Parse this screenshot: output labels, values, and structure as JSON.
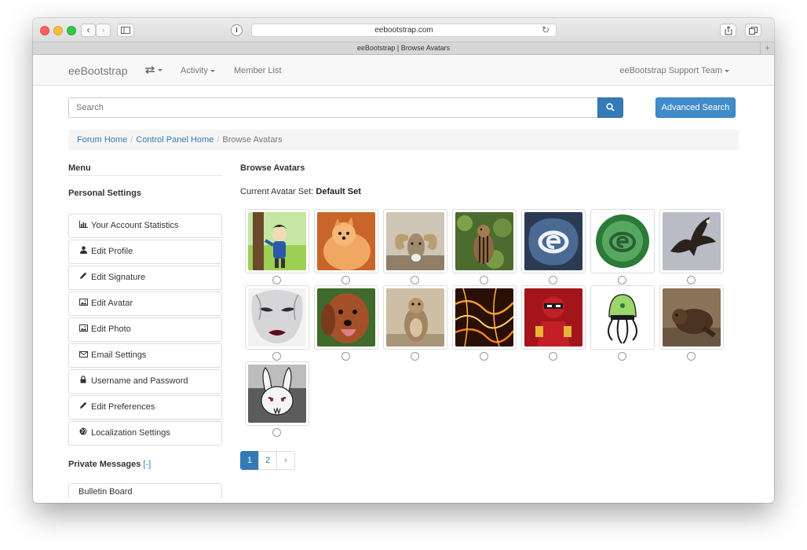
{
  "browser": {
    "url": "eebootstrap.com",
    "tab_title": "eeBootstrap | Browse Avatars"
  },
  "navbar": {
    "brand": "eeBootstrap",
    "activity": "Activity",
    "member_list": "Member List",
    "user_menu": "eeBootstrap Support Team"
  },
  "search": {
    "placeholder": "Search",
    "advanced_label": "Advanced Search"
  },
  "breadcrumb": {
    "items": [
      "Forum Home",
      "Control Panel Home"
    ],
    "current": "Browse Avatars"
  },
  "sidebar": {
    "menu_title": "Menu",
    "personal_title": "Personal Settings",
    "items": [
      {
        "label": "Your Account Statistics",
        "icon": "bar-chart-icon"
      },
      {
        "label": "Edit Profile",
        "icon": "user-icon"
      },
      {
        "label": "Edit Signature",
        "icon": "pencil-icon"
      },
      {
        "label": "Edit Avatar",
        "icon": "picture-icon"
      },
      {
        "label": "Edit Photo",
        "icon": "picture-icon"
      },
      {
        "label": "Email Settings",
        "icon": "envelope-icon"
      },
      {
        "label": "Username and Password",
        "icon": "lock-icon"
      },
      {
        "label": "Edit Preferences",
        "icon": "pencil-icon"
      },
      {
        "label": "Localization Settings",
        "icon": "globe-icon"
      }
    ],
    "pm_title": "Private Messages",
    "pm_toggle": "[-]",
    "cut_item": "Bulletin Board"
  },
  "main": {
    "title": "Browse Avatars",
    "current_set_label": "Current Avatar Set:",
    "current_set_value": "Default Set"
  },
  "pagination": {
    "pages": [
      "1",
      "2"
    ],
    "next": "›",
    "active_page": "1"
  },
  "colors": {
    "link": "#337ab7",
    "primary_button": "#428bca"
  }
}
